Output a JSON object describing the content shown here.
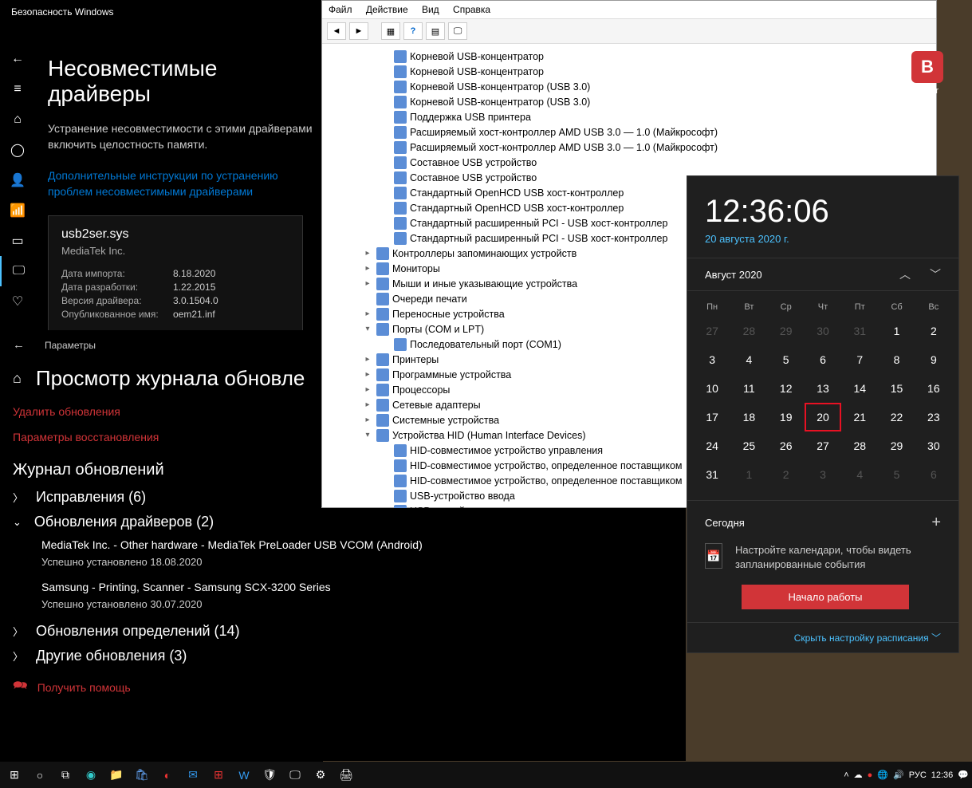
{
  "security": {
    "title": "Безопасность Windows",
    "heading": "Несовместимые драйверы",
    "desc": "Устранение несовместимости с этими драйверами включить целостность памяти.",
    "link": "Дополнительные инструкции по устранению проблем несовместимыми драйверами",
    "driver": {
      "name": "usb2ser.sys",
      "vendor": "MediaTek Inc.",
      "import_k": "Дата импорта:",
      "import_v": "8.18.2020",
      "dev_k": "Дата разработки:",
      "dev_v": "1.22.2015",
      "ver_k": "Версия драйвера:",
      "ver_v": "3.0.1504.0",
      "pub_k": "Опубликованное имя:",
      "pub_v": "oem21.inf"
    }
  },
  "settings": {
    "back_label": "Параметры",
    "heading": "Просмотр журнала обновле",
    "delete": "Удалить обновления",
    "recovery": "Параметры восстановления",
    "journal": "Журнал обновлений",
    "sec_fixes": "Исправления (6)",
    "sec_drivers": "Обновления драйверов (2)",
    "upd1_t": "MediaTek Inc. - Other hardware - MediaTek PreLoader USB VCOM (Android)",
    "upd1_s": "Успешно установлено 18.08.2020",
    "upd2_t": "Samsung - Printing, Scanner - Samsung SCX-3200 Series",
    "upd2_s": "Успешно установлено 30.07.2020",
    "sec_def": "Обновления определений (14)",
    "sec_other": "Другие обновления (3)",
    "help": "Получить помощь"
  },
  "devmgr": {
    "menu": {
      "file": "Файл",
      "action": "Действие",
      "view": "Вид",
      "help": "Справка"
    },
    "items": [
      {
        "lvl": 2,
        "txt": "Корневой USB-концентратор"
      },
      {
        "lvl": 2,
        "txt": "Корневой USB-концентратор"
      },
      {
        "lvl": 2,
        "txt": "Корневой USB-концентратор (USB 3.0)"
      },
      {
        "lvl": 2,
        "txt": "Корневой USB-концентратор (USB 3.0)"
      },
      {
        "lvl": 2,
        "txt": "Поддержка USB принтера"
      },
      {
        "lvl": 2,
        "txt": "Расширяемый хост-контроллер AMD USB 3.0 — 1.0 (Майкрософт)"
      },
      {
        "lvl": 2,
        "txt": "Расширяемый хост-контроллер AMD USB 3.0 — 1.0 (Майкрософт)"
      },
      {
        "lvl": 2,
        "txt": "Составное USB устройство"
      },
      {
        "lvl": 2,
        "txt": "Составное USB устройство"
      },
      {
        "lvl": 2,
        "txt": "Стандартный OpenHCD USB хост-контроллер"
      },
      {
        "lvl": 2,
        "txt": "Стандартный OpenHCD USB хост-контроллер"
      },
      {
        "lvl": 2,
        "txt": "Стандартный расширенный PCI - USB хост-контроллер"
      },
      {
        "lvl": 2,
        "txt": "Стандартный расширенный PCI - USB хост-контроллер"
      },
      {
        "lvl": 1,
        "exp": "▸",
        "txt": "Контроллеры запоминающих устройств"
      },
      {
        "lvl": 1,
        "exp": "▸",
        "txt": "Мониторы"
      },
      {
        "lvl": 1,
        "exp": "▸",
        "txt": "Мыши и иные указывающие устройства"
      },
      {
        "lvl": 1,
        "exp": "",
        "txt": "Очереди печати"
      },
      {
        "lvl": 1,
        "exp": "▸",
        "txt": "Переносные устройства"
      },
      {
        "lvl": 1,
        "exp": "▾",
        "txt": "Порты (COM и LPT)"
      },
      {
        "lvl": 2,
        "txt": "Последовательный порт (COM1)"
      },
      {
        "lvl": 1,
        "exp": "▸",
        "txt": "Принтеры"
      },
      {
        "lvl": 1,
        "exp": "▸",
        "txt": "Программные устройства"
      },
      {
        "lvl": 1,
        "exp": "▸",
        "txt": "Процессоры"
      },
      {
        "lvl": 1,
        "exp": "▸",
        "txt": "Сетевые адаптеры"
      },
      {
        "lvl": 1,
        "exp": "▸",
        "txt": "Системные устройства"
      },
      {
        "lvl": 1,
        "exp": "▾",
        "txt": "Устройства HID (Human Interface Devices)"
      },
      {
        "lvl": 2,
        "txt": "HID-совместимое устройство управления"
      },
      {
        "lvl": 2,
        "txt": "HID-совместимое устройство, определенное поставщиком"
      },
      {
        "lvl": 2,
        "txt": "HID-совместимое устройство, определенное поставщиком"
      },
      {
        "lvl": 2,
        "txt": "USB-устройство ввода"
      },
      {
        "lvl": 2,
        "txt": "USB-устройство ввода"
      }
    ]
  },
  "clock": {
    "time": "12:36:06",
    "date": "20 августа 2020 г.",
    "month": "Август 2020",
    "dow": [
      "Пн",
      "Вт",
      "Ср",
      "Чт",
      "Пт",
      "Сб",
      "Вс"
    ],
    "weeks": [
      [
        {
          "d": 27,
          "dim": true
        },
        {
          "d": 28,
          "dim": true
        },
        {
          "d": 29,
          "dim": true
        },
        {
          "d": 30,
          "dim": true
        },
        {
          "d": 31,
          "dim": true
        },
        {
          "d": 1
        },
        {
          "d": 2
        }
      ],
      [
        {
          "d": 3
        },
        {
          "d": 4
        },
        {
          "d": 5
        },
        {
          "d": 6
        },
        {
          "d": 7
        },
        {
          "d": 8
        },
        {
          "d": 9
        }
      ],
      [
        {
          "d": 10
        },
        {
          "d": 11
        },
        {
          "d": 12
        },
        {
          "d": 13
        },
        {
          "d": 14
        },
        {
          "d": 15
        },
        {
          "d": 16
        }
      ],
      [
        {
          "d": 17
        },
        {
          "d": 18
        },
        {
          "d": 19
        },
        {
          "d": 20,
          "today": true
        },
        {
          "d": 21
        },
        {
          "d": 22
        },
        {
          "d": 23
        }
      ],
      [
        {
          "d": 24
        },
        {
          "d": 25
        },
        {
          "d": 26
        },
        {
          "d": 27
        },
        {
          "d": 28
        },
        {
          "d": 29
        },
        {
          "d": 30
        }
      ],
      [
        {
          "d": 31
        },
        {
          "d": 1,
          "dim": true
        },
        {
          "d": 2,
          "dim": true
        },
        {
          "d": 3,
          "dim": true
        },
        {
          "d": 4,
          "dim": true
        },
        {
          "d": 5,
          "dim": true
        },
        {
          "d": 6,
          "dim": true
        }
      ]
    ],
    "today": "Сегодня",
    "setup": "Настройте календари, чтобы видеть запланированные события",
    "start": "Начало работы",
    "hide": "Скрыть настройку расписания"
  },
  "taskbar": {
    "lang": "РУС",
    "time": "12:36"
  },
  "desk": {
    "bitdef": "ender"
  }
}
